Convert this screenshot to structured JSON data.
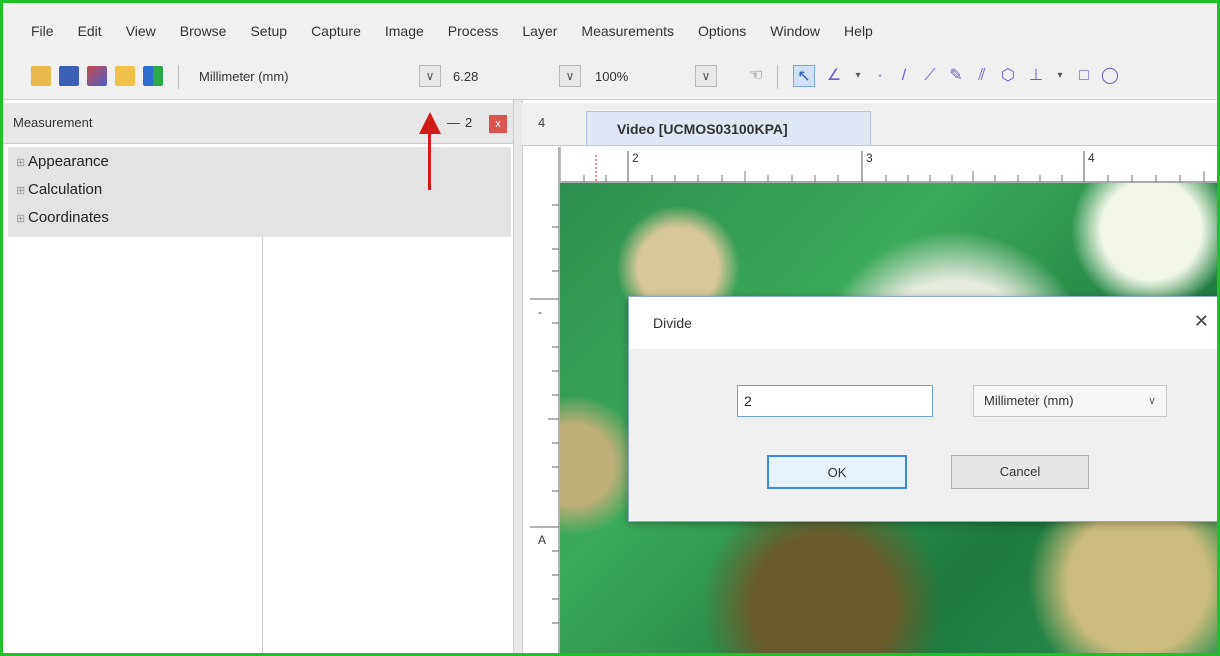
{
  "menu": [
    "File",
    "Edit",
    "View",
    "Browse",
    "Setup",
    "Capture",
    "Image",
    "Process",
    "Layer",
    "Measurements",
    "Options",
    "Window",
    "Help"
  ],
  "toolbar": {
    "unit_value": "Millimeter (mm)",
    "scale_value": "6.28",
    "zoom_value": "100%"
  },
  "panel": {
    "title": "Measurement",
    "pin": "—",
    "num": "2",
    "close": "x",
    "tree_items": [
      "Appearance",
      "Calculation",
      "Coordinates"
    ]
  },
  "tabs": {
    "count": "4",
    "active_label": "Video [UCMOS03100KPA]"
  },
  "ruler": {
    "h_labels": [
      "2",
      "3",
      "4"
    ],
    "v_labels": [
      "-",
      "A"
    ]
  },
  "dialog": {
    "title": "Divide",
    "close_glyph": "✕",
    "input_value": "2",
    "unit_select": "Millimeter (mm)",
    "ok_label": "OK",
    "cancel_label": "Cancel"
  },
  "colors": {
    "frame": "#22c028",
    "arrow": "#d11a1a",
    "ok_border": "#3c8ad8"
  }
}
